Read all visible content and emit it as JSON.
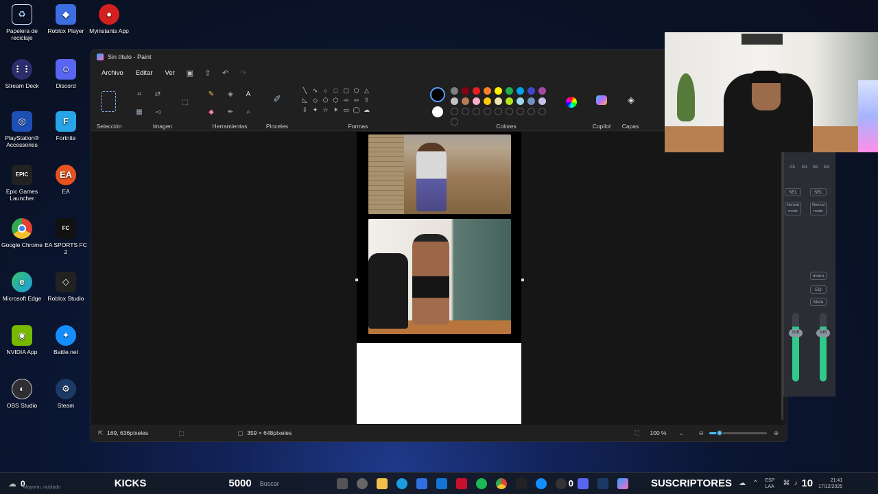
{
  "desktop": {
    "icons": [
      {
        "label": "Papelera de reciclaje",
        "icon": "recycle-bin-icon",
        "color": "#4aa3ff"
      },
      {
        "label": "Roblox Player",
        "icon": "roblox-icon",
        "color": "#3c6ee0"
      },
      {
        "label": "Myinstants App",
        "icon": "myinstants-icon",
        "color": "#d42020"
      },
      {
        "label": "Stream Deck",
        "icon": "stream-deck-icon",
        "color": "#2b2d6e"
      },
      {
        "label": "Discord",
        "icon": "discord-icon",
        "color": "#5865f2"
      },
      {
        "label": "PlayStation® Accessories",
        "icon": "playstation-icon",
        "color": "#1e4fb5"
      },
      {
        "label": "Fortnite",
        "icon": "fortnite-icon",
        "color": "#27a5e8"
      },
      {
        "label": "Epic Games Launcher",
        "icon": "epic-games-icon",
        "color": "#222222"
      },
      {
        "label": "EA",
        "icon": "ea-icon",
        "color": "#e8521e"
      },
      {
        "label": "Google Chrome",
        "icon": "chrome-icon",
        "color": "#e34133"
      },
      {
        "label": "EA SPORTS FC 2",
        "icon": "ea-fc-icon",
        "color": "#111111"
      },
      {
        "label": "Microsoft Edge",
        "icon": "edge-icon",
        "color": "#1b9de2"
      },
      {
        "label": "Roblox Studio",
        "icon": "roblox-studio-icon",
        "color": "#222222"
      },
      {
        "label": "NVIDIA App",
        "icon": "nvidia-icon",
        "color": "#76b900"
      },
      {
        "label": "Battle.net",
        "icon": "battlenet-icon",
        "color": "#148eff"
      },
      {
        "label": "OBS Studio",
        "icon": "obs-icon",
        "color": "#302e31"
      },
      {
        "label": "Steam",
        "icon": "steam-icon",
        "color": "#1b3a66"
      }
    ]
  },
  "paint": {
    "title": "Sin título - Paint",
    "menus": [
      "Archivo",
      "Editar",
      "Ver"
    ],
    "groups": {
      "seleccion": "Selección",
      "imagen": "Imagen",
      "herramientas": "Herramientas",
      "pinceles": "Pinceles",
      "formas": "Formas",
      "colores": "Colores",
      "copilot": "Copilot",
      "capas": "Capas"
    },
    "colors_row1": [
      "#000000",
      "#7f7f7f",
      "#880015",
      "#ed1c24",
      "#ff7f27",
      "#fff200",
      "#22b14c",
      "#00a2e8",
      "#3f48cc",
      "#a349a4"
    ],
    "colors_row2": [
      "#ffffff",
      "#c3c3c3",
      "#b97a57",
      "#ffaec9",
      "#ffc90e",
      "#efe4b0",
      "#b5e61d",
      "#99d9ea",
      "#7092be",
      "#c8bfe7"
    ],
    "status": {
      "cursor_pos": "169, 636píxeles",
      "canvas_size": "359 × 648píxeles",
      "zoom": "100 %",
      "zoom_fraction": 0.18
    }
  },
  "mixer": {
    "labels": [
      "A5",
      "B1",
      "B2",
      "B3"
    ],
    "sel": "SEL",
    "mode": "Normal mode",
    "mono": "mono",
    "eq": "EQ",
    "mute": "Mute",
    "gain": "0dB",
    "fader_label": "Fader Gain"
  },
  "taskbar": {
    "weather_temp": "0",
    "weather_text": "Mayorm. nublado",
    "kicks_label": "KICKS",
    "kicks_count": "5000",
    "search_placeholder": "Buscar",
    "discord_badge": "0",
    "subs_label": "SUSCRIPTORES",
    "lang_top": "ESP",
    "lang_bottom": "LAA",
    "subs_count": "10",
    "time": "21:41",
    "date": "17/12/2025"
  }
}
